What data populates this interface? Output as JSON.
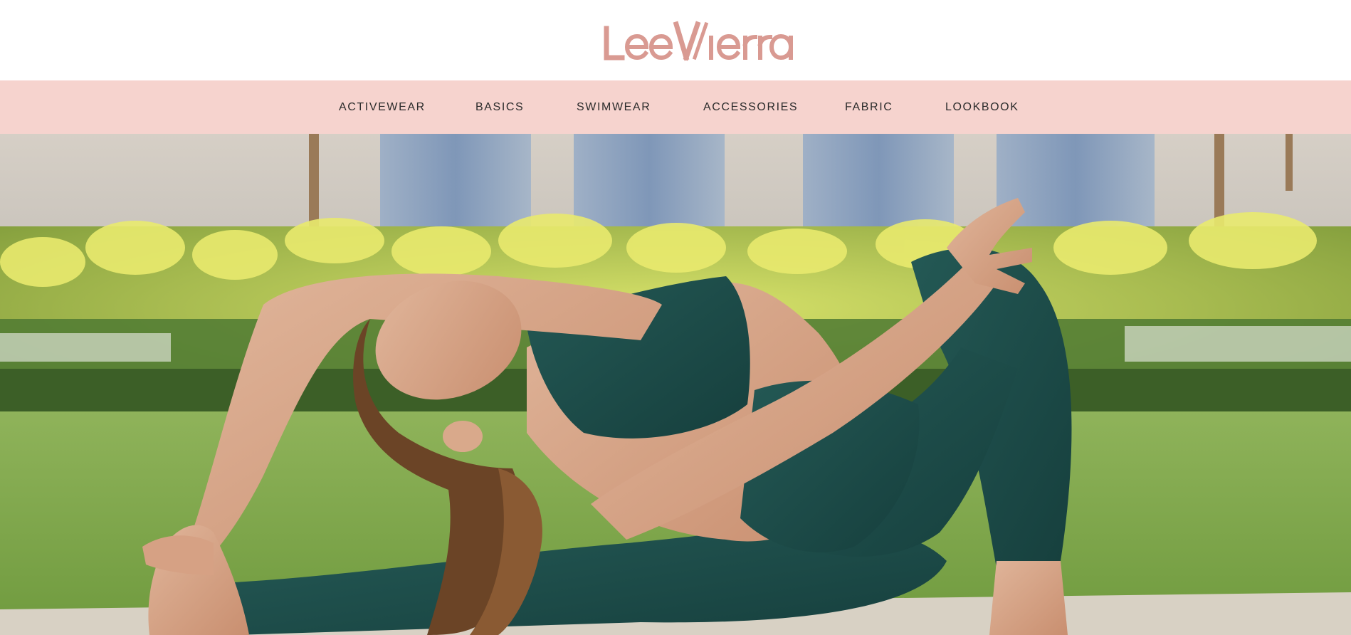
{
  "brand": {
    "name": "LeeVierra",
    "color": "#d99a92"
  },
  "nav": {
    "background": "#f6d3ce",
    "items": [
      {
        "label": "ACTIVEWEAR"
      },
      {
        "label": "BASICS"
      },
      {
        "label": "SWIMWEAR"
      },
      {
        "label": "ACCESSORIES"
      },
      {
        "label": "FABRIC"
      },
      {
        "label": "LOOKBOOK"
      }
    ]
  },
  "hero": {
    "image": "woman-in-teal-activewear-doing-yoga-stretch-on-lawn"
  }
}
